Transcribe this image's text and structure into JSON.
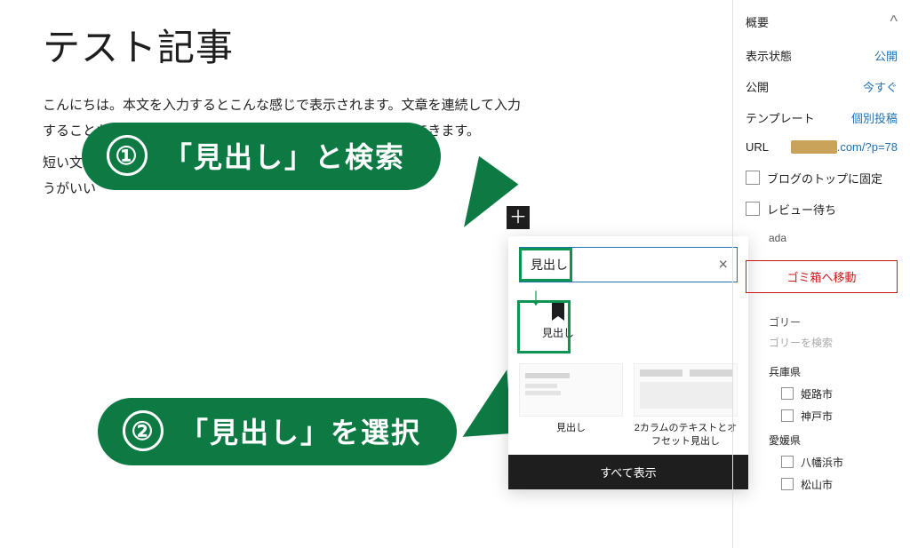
{
  "post": {
    "title": "テスト記事",
    "para1_line1": "こんにちは。本文を入力するとこんな感じで表示されます。文章を連続して入力",
    "para1_line2": "することもできますし、エンターキーを押して改行することもできます。",
    "para2_line1": "短い文章",
    "para2_line2": "うがいい"
  },
  "callouts": {
    "step1_num": "①",
    "step1_text": "「見出し」と検索",
    "step2_num": "②",
    "step2_text": "「見出し」を選択"
  },
  "inserter": {
    "add_plus": "＋",
    "search_value": "見出し",
    "clear_glyph": "×",
    "result_label": "見出し",
    "pattern1_caption": "見出し",
    "pattern2_caption": "2カラムのテキストとオフセット見出し",
    "show_all": "すべて表示"
  },
  "sidebar": {
    "summary_title": "概要",
    "chevron_up": "^",
    "rows": {
      "visibility_label": "表示状態",
      "visibility_value": "公開",
      "publish_label": "公開",
      "publish_value": "今すぐ",
      "template_label": "テンプレート",
      "template_value": "個別投稿",
      "url_label": "URL",
      "url_value_suffix": ".com/?p=78"
    },
    "sticky": {
      "label": "ブログのトップに固定"
    },
    "pending": {
      "label": "レビュー待ち"
    },
    "author_value": "ada",
    "trash": "ゴミ箱へ移動",
    "category_title": "ゴリー",
    "category_search_placeholder": "ゴリーを検索",
    "groups": {
      "g1": {
        "label": "兵庫県",
        "c1": "姫路市",
        "c2": "神戸市"
      },
      "g2": {
        "label": "愛媛県",
        "c1": "八幡浜市",
        "c2": "松山市"
      }
    }
  }
}
